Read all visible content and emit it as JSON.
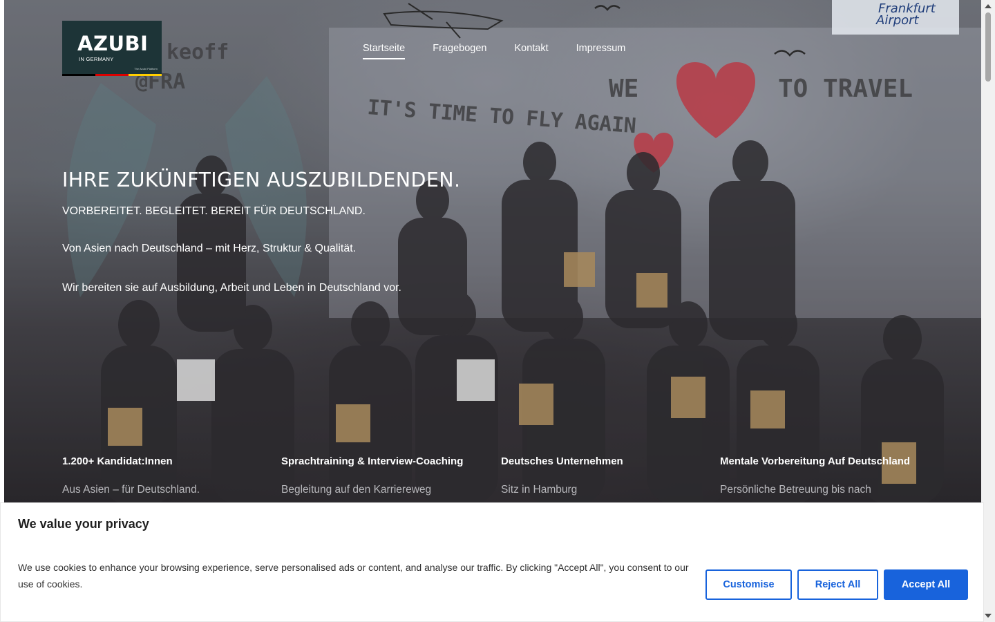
{
  "logo": {
    "main": "AZUBI",
    "sub": "IN GERMANY",
    "tiny": "The Azubi Platform",
    "flag_colors": [
      "#000000",
      "#dd0000",
      "#ffce00"
    ]
  },
  "nav": {
    "items": [
      {
        "label": "Startseite",
        "active": true
      },
      {
        "label": "Fragebogen",
        "active": false
      },
      {
        "label": "Kontakt",
        "active": false
      },
      {
        "label": "Impressum",
        "active": false
      }
    ]
  },
  "hero": {
    "title": "IHRE ZUKÜNFTIGEN AUSZUBILDENDEN.",
    "subtitle": "VORBEREITET. BEGLEITET. BEREIT FÜR DEUTSCHLAND.",
    "line1": "Von Asien nach Deutschland – mit Herz, Struktur & Qualität.",
    "line2": "Wir bereiten sie auf Ausbildung, Arbeit und Leben in Deutschland vor.",
    "photo_text": {
      "wall_slogan": "IT'S TIME TO FLY AGAIN",
      "wall_travel_left": "WE",
      "wall_travel_right": "TO TRAVEL",
      "airport_line1": "Frankfurt",
      "airport_line2": "Airport",
      "takeoff": "keoff",
      "graffiti": "@FRA"
    }
  },
  "features": [
    {
      "title": "1.200+ Kandidat:Innen",
      "text": "Aus Asien – für Deutschland."
    },
    {
      "title": "Sprachtraining & Interview-Coaching",
      "text": "Begleitung auf den Karriereweg"
    },
    {
      "title": "Deutsches Unternehmen",
      "text": "Sitz in Hamburg"
    },
    {
      "title": "Mentale Vorbereitung Auf Deutschland",
      "text": "Persönliche Betreuung bis nach"
    }
  ],
  "cookie": {
    "title": "We value your privacy",
    "text": "We use cookies to enhance your browsing experience, serve personalised ads or content, and analyse our traffic. By clicking \"Accept All\", you consent to our use of cookies.",
    "customise_label": "Customise",
    "reject_label": "Reject All",
    "accept_label": "Accept All",
    "accent_color": "#1863dc"
  }
}
